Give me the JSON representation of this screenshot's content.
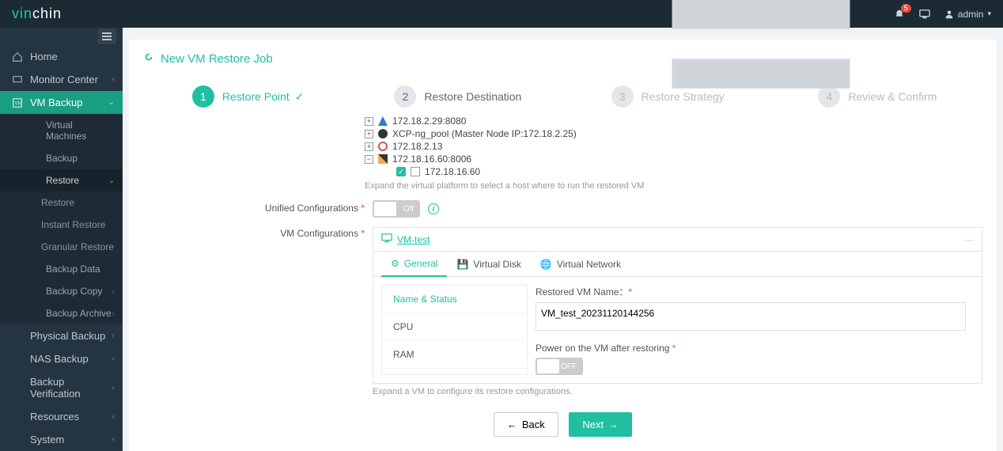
{
  "brand": {
    "p1": "vin",
    "p2": "chin"
  },
  "topbar": {
    "notif_count": "5",
    "user": "admin"
  },
  "sidebar": {
    "home": "Home",
    "monitor": "Monitor Center",
    "vmbackup": "VM Backup",
    "sub": {
      "vms": "Virtual Machines",
      "backup": "Backup",
      "restore": "Restore",
      "restore2": "Restore",
      "instant": "Instant Restore",
      "granular": "Granular Restore",
      "bdata": "Backup Data",
      "bcopy": "Backup Copy",
      "barchive": "Backup Archive"
    },
    "physical": "Physical Backup",
    "nas": "NAS Backup",
    "verify": "Backup Verification",
    "resources": "Resources",
    "system": "System"
  },
  "panel": {
    "title": "New VM Restore Job"
  },
  "wizard": {
    "s1": {
      "num": "1",
      "label": "Restore Point"
    },
    "s2": {
      "num": "2",
      "label": "Restore Destination"
    },
    "s3": {
      "num": "3",
      "label": "Restore Strategy"
    },
    "s4": {
      "num": "4",
      "label": "Review & Confirm"
    }
  },
  "tree": {
    "n1": "172.18.2.29:8080",
    "n2": "XCP-ng_pool (Master Node IP:172.18.2.25)",
    "n3": "172.18.2.13",
    "n4": "172.18.16.60:8006",
    "n5": "172.18.16.60",
    "hint": "Expand the virtual platform to select a host where to run the restored VM"
  },
  "form": {
    "unified": "Unified Configurations",
    "vmconf": "VM Configurations",
    "off": "Off",
    "off2": "OFF"
  },
  "vm": {
    "name": "VM-test",
    "tabs": {
      "general": "General",
      "vdisk": "Virtual Disk",
      "vnet": "Virtual Network"
    },
    "side": {
      "ns": "Name & Status",
      "cpu": "CPU",
      "ram": "RAM"
    },
    "restored_label": "Restored VM Name：",
    "restored_val": "VM_test_20231120144256",
    "power_label": "Power on the VM after restoring",
    "hint2": "Expand a VM to configure its restore configurations."
  },
  "actions": {
    "back": "Back",
    "next": "Next"
  }
}
